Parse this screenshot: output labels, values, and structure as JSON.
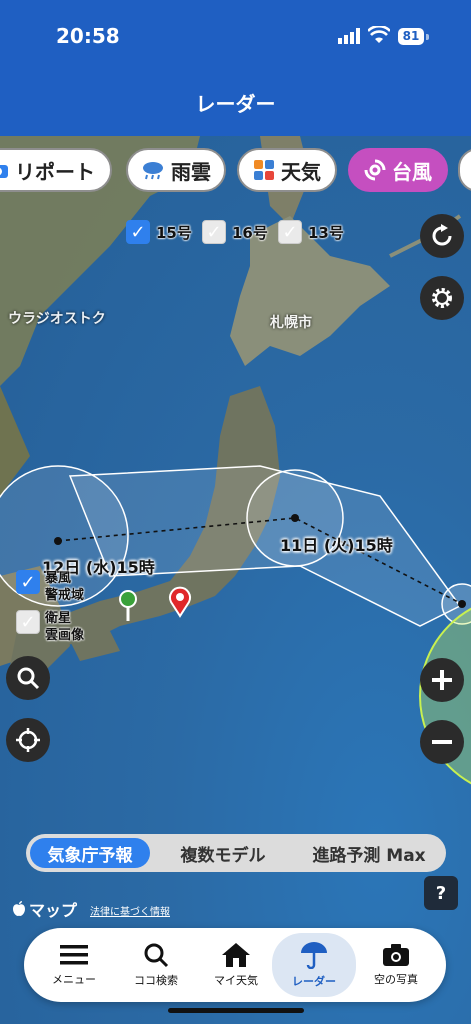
{
  "status": {
    "time": "20:58",
    "battery": "81"
  },
  "header": {
    "title": "レーダー"
  },
  "chips": [
    {
      "label": "リポート",
      "icon": "camera-icon"
    },
    {
      "label": "雨雲",
      "icon": "rain-cloud-icon"
    },
    {
      "label": "天気",
      "icon": "weather-grid-icon"
    },
    {
      "label": "台風",
      "icon": "typhoon-icon",
      "active": true
    }
  ],
  "typhoon_filters": [
    {
      "label": "15号",
      "checked": true
    },
    {
      "label": "16号",
      "checked": false
    },
    {
      "label": "13号",
      "checked": false
    }
  ],
  "map": {
    "labels": {
      "vladivostok": "ウラジオストク",
      "sapporo": "札幌市",
      "forecast_a": "12日 (水)15時",
      "forecast_b": "11日 (火)15時"
    }
  },
  "layers": {
    "storm_label": "暴風\n警戒域",
    "satellite_label": "衛星\n雲画像"
  },
  "segments": [
    "気象庁予報",
    "複数モデル",
    "進路予測 Max"
  ],
  "footer": {
    "apple_maps": "マップ",
    "legal": "法律に基づく情報",
    "help": "?"
  },
  "tabs": [
    {
      "label": "メニュー",
      "icon": "menu-icon"
    },
    {
      "label": "ココ検索",
      "icon": "search-icon"
    },
    {
      "label": "マイ天気",
      "icon": "home-icon"
    },
    {
      "label": "レーダー",
      "icon": "umbrella-icon",
      "active": true
    },
    {
      "label": "空の写真",
      "icon": "camera-icon"
    }
  ],
  "colors": {
    "header": "#1f5fc2",
    "typhoon_chip": "#c54fc0",
    "accent": "#2f80ed",
    "forecast_circle": "#c8f050"
  }
}
